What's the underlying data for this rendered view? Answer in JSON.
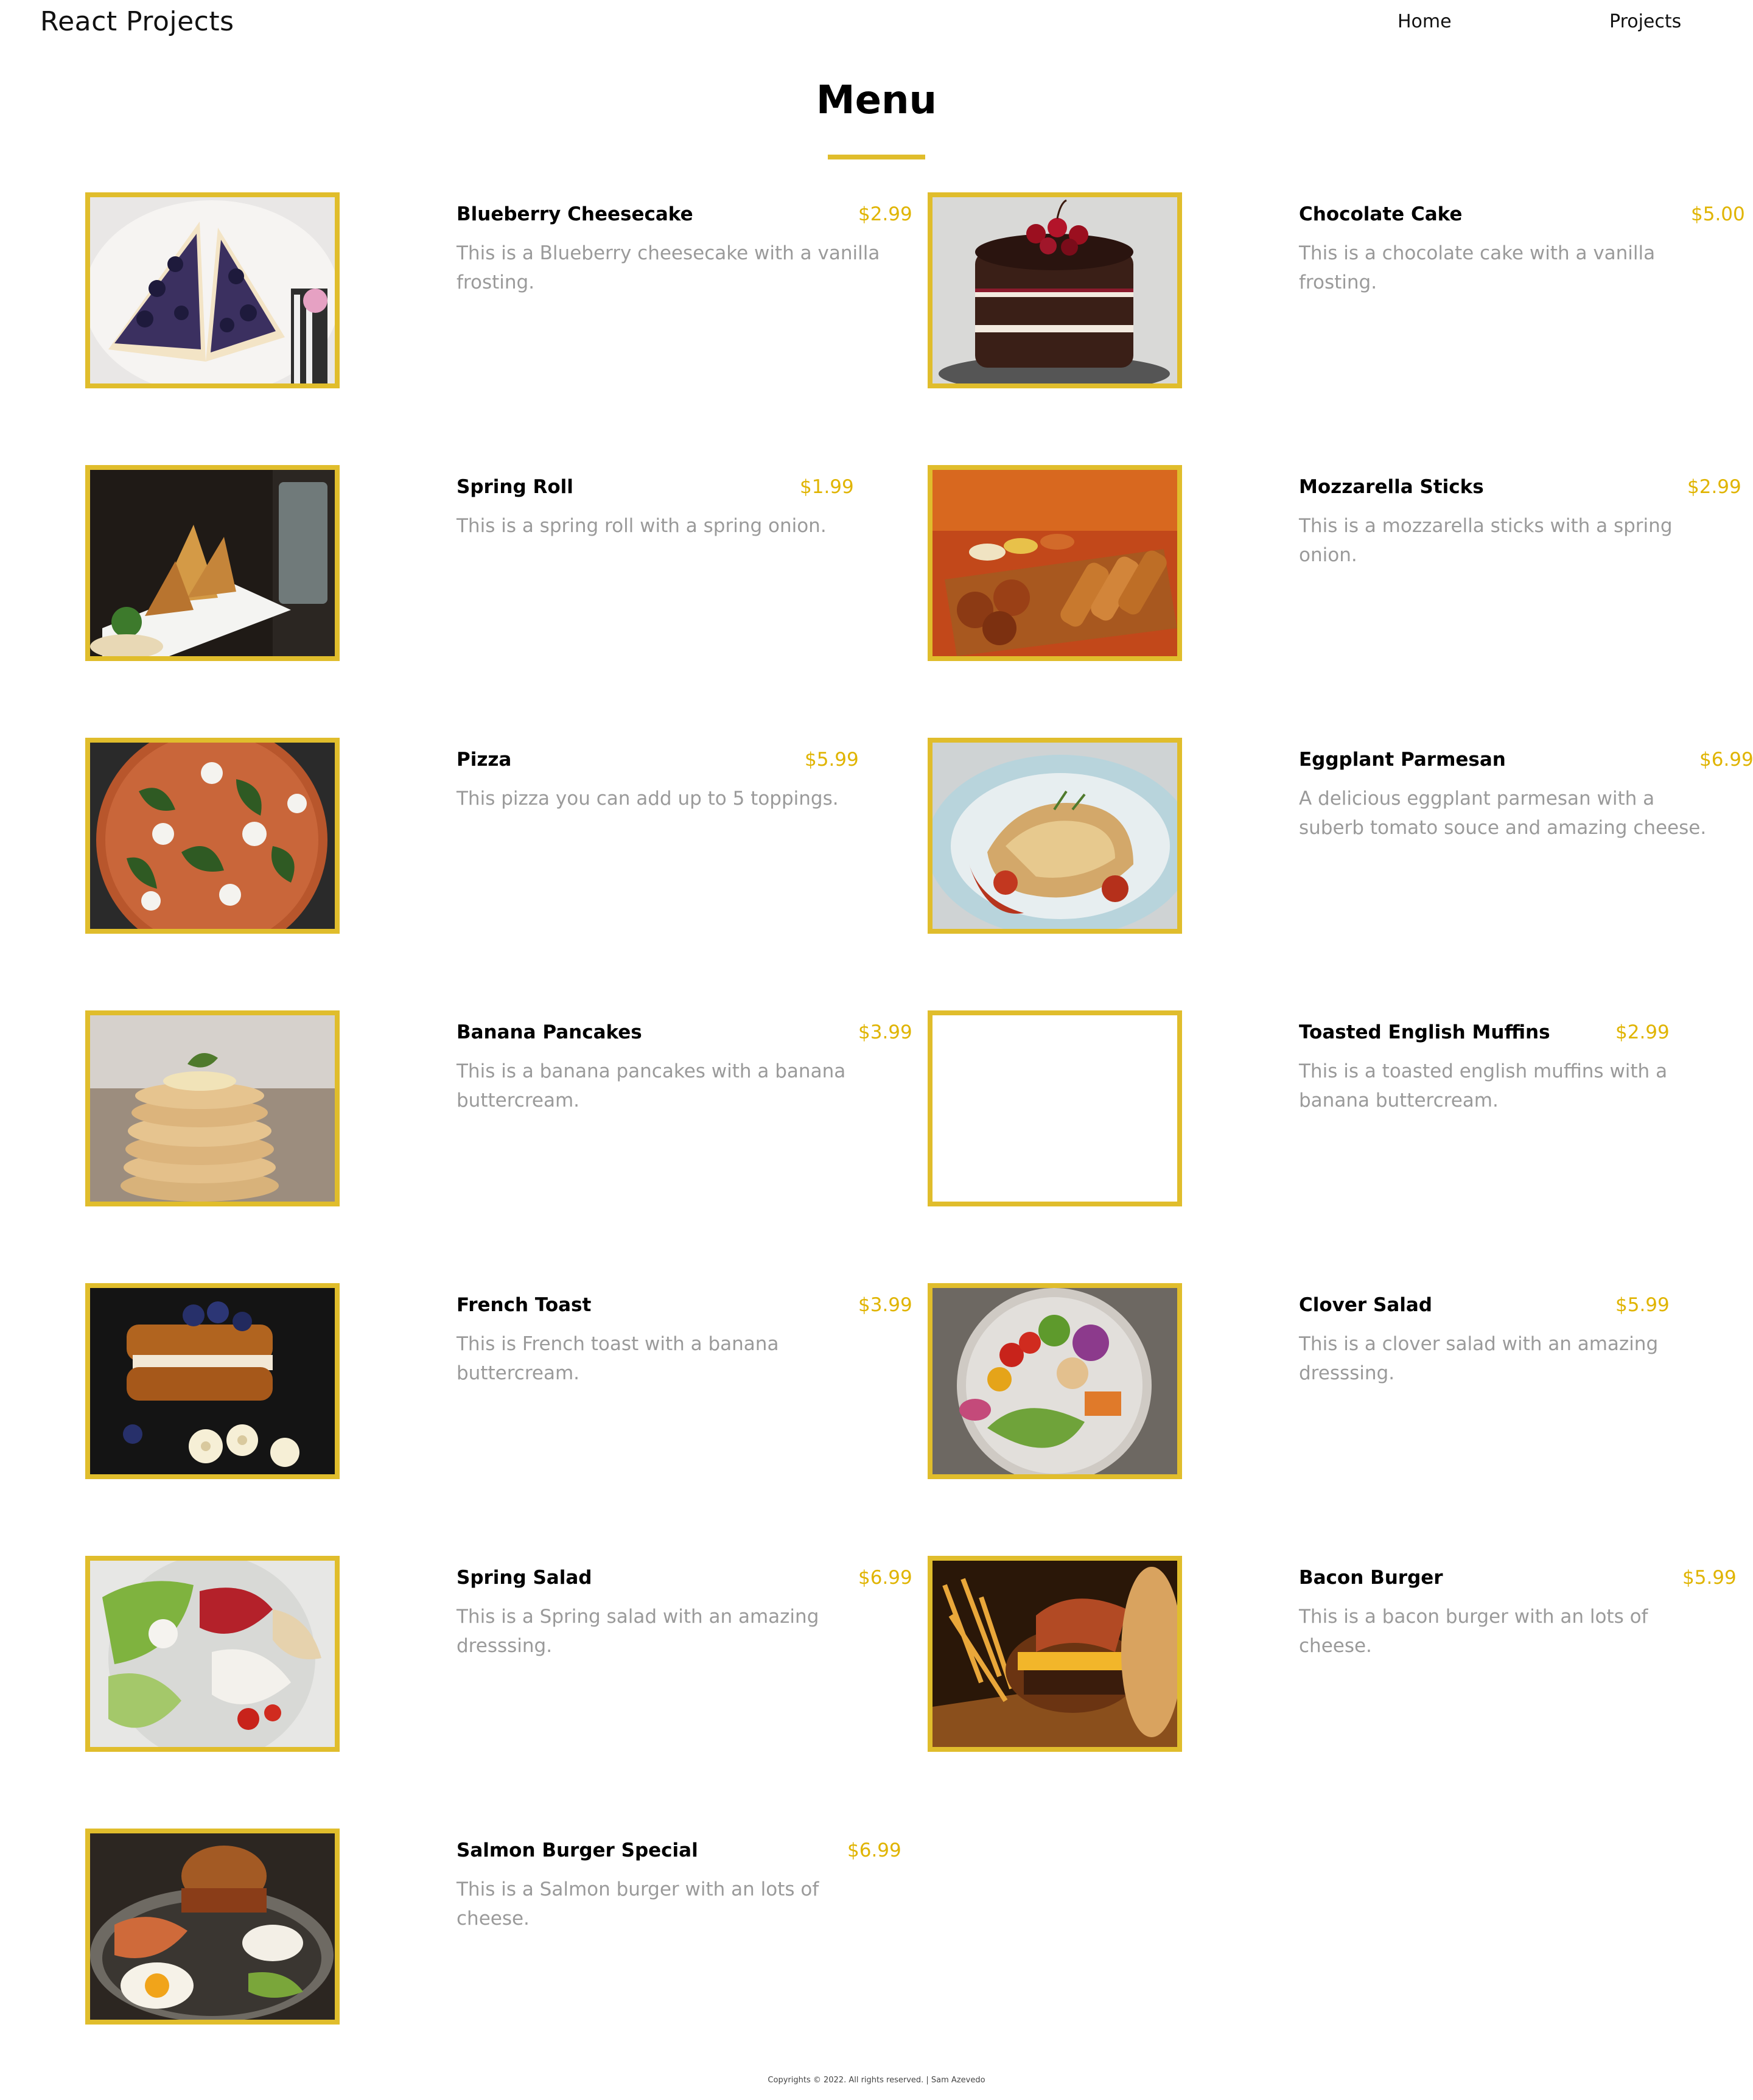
{
  "nav": {
    "brand": "React Projects",
    "links": [
      "Home",
      "Projects"
    ]
  },
  "page": {
    "title": "Menu"
  },
  "colors": {
    "accent": "#e0bd2c",
    "price": "#e0b400",
    "description": "#9a9a9a"
  },
  "menu": {
    "items": [
      {
        "name": "Blueberry Cheesecake",
        "price": "$2.99",
        "desc": "This is a Blueberry cheesecake with a vanilla frosting.",
        "image": "blueberry-cheesecake"
      },
      {
        "name": "Chocolate Cake",
        "price": "$5.00",
        "desc": "This is a chocolate cake with a vanilla frosting.",
        "image": "chocolate-cake"
      },
      {
        "name": "Spring Roll",
        "price": "$1.99",
        "desc": "This is a spring roll with a spring onion.",
        "image": "spring-roll"
      },
      {
        "name": "Mozzarella Sticks",
        "price": "$2.99",
        "desc": "This is a mozzarella sticks with a spring onion.",
        "image": "mozzarella-sticks"
      },
      {
        "name": "Pizza",
        "price": "$5.99",
        "desc": "This pizza you can add up to 5 toppings.",
        "image": "pizza"
      },
      {
        "name": "Eggplant Parmesan",
        "price": "$6.99",
        "desc": "A delicious eggplant parmesan with a suberb tomato souce and amazing cheese.",
        "image": "eggplant-parmesan"
      },
      {
        "name": "Banana Pancakes",
        "price": "$3.99",
        "desc": "This is a banana pancakes with a banana buttercream.",
        "image": "banana-pancakes"
      },
      {
        "name": "Toasted English Muffins",
        "price": "$2.99",
        "desc": "This is a toasted english muffins with a banana buttercream.",
        "image": "empty"
      },
      {
        "name": "French Toast",
        "price": "$3.99",
        "desc": "This is French toast with a banana buttercream.",
        "image": "french-toast"
      },
      {
        "name": "Clover Salad",
        "price": "$5.99",
        "desc": "This is a clover salad with an amazing dresssing.",
        "image": "clover-salad"
      },
      {
        "name": "Spring Salad",
        "price": "$6.99",
        "desc": "This is a Spring salad with an amazing dresssing.",
        "image": "spring-salad"
      },
      {
        "name": "Bacon Burger",
        "price": "$5.99",
        "desc": "This is a bacon burger with an lots of cheese.",
        "image": "bacon-burger"
      },
      {
        "name": "Salmon Burger Special",
        "price": "$6.99",
        "desc": "This is a Salmon burger with an lots of cheese.",
        "image": "salmon-burger"
      }
    ]
  },
  "footer": {
    "text": "Copyrights © 2022. All rights reserved. | Sam Azevedo"
  }
}
